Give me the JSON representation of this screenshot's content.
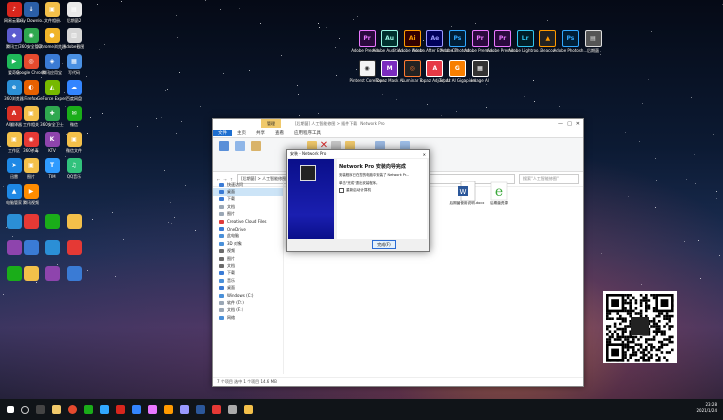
{
  "desktop_icons_left": [
    {
      "label": "网易云音乐",
      "color": "#d8261d",
      "glyph": "♪"
    },
    {
      "label": "Easy Downlo...",
      "color": "#2b5fa8",
      "glyph": "↓"
    },
    {
      "label": "文件相册",
      "color": "#f3c04a",
      "glyph": "▣"
    },
    {
      "label": "后期菌2",
      "color": "#e9e9e9",
      "glyph": "▤"
    },
    {
      "label": "腾讯工厂",
      "color": "#5c5ccf",
      "glyph": "◆"
    },
    {
      "label": "360安全管家",
      "color": "#2fa84f",
      "glyph": "◉"
    },
    {
      "label": "Chrome浏览器",
      "color": "#f0b429",
      "glyph": "●"
    },
    {
      "label": "Adobe截图",
      "color": "#d6d6d6",
      "glyph": "▥"
    },
    {
      "label": "爱奇艺",
      "color": "#1fb85a",
      "glyph": "▶"
    },
    {
      "label": "Google Chrome",
      "color": "#e64a2e",
      "glyph": "◎"
    },
    {
      "label": "腾讯应用宝",
      "color": "#3a7bd5",
      "glyph": "◈"
    },
    {
      "label": "写代码",
      "color": "#4a90e2",
      "glyph": "▦"
    },
    {
      "label": "360浏览器",
      "color": "#2b8fd6",
      "glyph": "e"
    },
    {
      "label": "Firefox",
      "color": "#e66000",
      "glyph": "◐"
    },
    {
      "label": "GeForce Experience",
      "color": "#76b900",
      "glyph": "◭"
    },
    {
      "label": "百度网盘",
      "color": "#3385ff",
      "glyph": "☁"
    },
    {
      "label": "AI翻译器",
      "color": "#d93025",
      "glyph": "A"
    },
    {
      "label": "工作相关",
      "color": "#f3c04a",
      "glyph": "▣"
    },
    {
      "label": "360安全卫士",
      "color": "#2fa84f",
      "glyph": "✚"
    },
    {
      "label": "微信",
      "color": "#1aad19",
      "glyph": "✉"
    },
    {
      "label": "工作区",
      "color": "#f3c04a",
      "glyph": "▣"
    },
    {
      "label": "360杀毒",
      "color": "#e53935",
      "glyph": "◉"
    },
    {
      "label": "KTV",
      "color": "#8e44ad",
      "glyph": "K"
    },
    {
      "label": "微信文件",
      "color": "#f3c04a",
      "glyph": "▣"
    },
    {
      "label": "迅雷",
      "color": "#1e88e5",
      "glyph": "➤"
    },
    {
      "label": "图片",
      "color": "#f3c04a",
      "glyph": "▣"
    },
    {
      "label": "TIM",
      "color": "#2f9bff",
      "glyph": "T"
    },
    {
      "label": "QQ音乐",
      "color": "#31c27c",
      "glyph": "♫"
    },
    {
      "label": "电脑管家",
      "color": "#1e88e5",
      "glyph": "▲"
    },
    {
      "label": "腾讯视频",
      "color": "#ff8c00",
      "glyph": "▶"
    }
  ],
  "desktop_apps_top": [
    {
      "label": "Adobe Premie...",
      "text": "Pr",
      "bg": "#2a0a3d",
      "fg": "#ea77ff"
    },
    {
      "label": "Adobe Audition...",
      "text": "Au",
      "bg": "#00302e",
      "fg": "#9af7e4"
    },
    {
      "label": "Adobe Illustr...",
      "text": "Ai",
      "bg": "#330000",
      "fg": "#ff9a00"
    },
    {
      "label": "Adobe After Effects CC",
      "text": "Ae",
      "bg": "#00005b",
      "fg": "#9999ff"
    },
    {
      "label": "Adobe Photosh...",
      "text": "Ps",
      "bg": "#001e36",
      "fg": "#31a8ff"
    },
    {
      "label": "Adobe Premie...",
      "text": "Pr",
      "bg": "#2a0a3d",
      "fg": "#ea77ff"
    },
    {
      "label": "Adobe Premie...",
      "text": "Pr",
      "bg": "#2a0a3d",
      "fg": "#ea77ff"
    },
    {
      "label": "Adobe Lightroo...",
      "text": "Lr",
      "bg": "#001d26",
      "fg": "#31c5f0"
    },
    {
      "label": "Beacon",
      "text": "▲",
      "bg": "#222",
      "fg": "#ff9a00"
    },
    {
      "label": "Adobe Photosh...",
      "text": "Ps",
      "bg": "#001e36",
      "fg": "#31a8ff"
    },
    {
      "label": "后期菌",
      "text": "▤",
      "bg": "#555",
      "fg": "#ddd"
    }
  ],
  "desktop_apps_row2": [
    {
      "label": "Pinterst CorelDee",
      "text": "◉",
      "bg": "#f4f4f4",
      "fg": "#333"
    },
    {
      "label": "Topaz Mask AI",
      "text": "M",
      "bg": "#7b2cbf",
      "fg": "#fff"
    },
    {
      "label": "Luminar 4",
      "text": "◎",
      "bg": "#222",
      "fg": "#ff7a30"
    },
    {
      "label": "Topaz Adjust AI",
      "text": "A",
      "bg": "#e63946",
      "fg": "#fff"
    },
    {
      "label": "Topaz AI Gigapixel",
      "text": "G",
      "bg": "#f77f00",
      "fg": "#fff"
    },
    {
      "label": "Image AI",
      "text": "▦",
      "bg": "#333",
      "fg": "#fff"
    }
  ],
  "explorer": {
    "title": "[后期菌] 人工智能修图 > 插件下载",
    "title_right": "Network Pro",
    "ribbon_tab_highlight": "管理",
    "tabs": [
      "文件",
      "主页",
      "共享",
      "查看",
      "应用程序工具"
    ],
    "address": "[后期菌] > 人工智能修图",
    "search_placeholder": "搜索\"人工智能修图\"",
    "nav_items": [
      {
        "label": "快速访问",
        "color": "#3a7bd5"
      },
      {
        "label": "桌面",
        "color": "#3a7bd5"
      },
      {
        "label": "下载",
        "color": "#3a7bd5"
      },
      {
        "label": "文档",
        "color": "#9aa7b5"
      },
      {
        "label": "图片",
        "color": "#9aa7b5"
      },
      {
        "label": "Creative Cloud Files",
        "color": "#e03a3a"
      },
      {
        "label": "OneDrive",
        "color": "#3a7bd5"
      },
      {
        "label": "此电脑",
        "color": "#4a90d9"
      },
      {
        "label": "3D 对象",
        "color": "#4a90d9"
      },
      {
        "label": "视频",
        "color": "#6b6b6b"
      },
      {
        "label": "图片",
        "color": "#6b6b6b"
      },
      {
        "label": "文档",
        "color": "#6b6b6b"
      },
      {
        "label": "下载",
        "color": "#3a7bd5"
      },
      {
        "label": "音乐",
        "color": "#4a90d9"
      },
      {
        "label": "桌面",
        "color": "#3a7bd5"
      },
      {
        "label": "Windows (C:)",
        "color": "#4a90d9"
      },
      {
        "label": "软件 (D:)",
        "color": "#9aa7b5"
      },
      {
        "label": "文档 (E:)",
        "color": "#9aa7b5"
      },
      {
        "label": "网络",
        "color": "#4a90d9"
      }
    ],
    "files": [
      {
        "label": "后期菌使用说明.docx",
        "type": "word"
      },
      {
        "label": "后期菌资源",
        "type": "ie"
      }
    ],
    "status": "7 个项目   选中 1 个项目  14.6 MB"
  },
  "dialog": {
    "title": "安装 - Network Pro",
    "heading": "Network Pro 安装向导完成",
    "para1": "安装程序已在您的电脑中安装了 Network Pr...",
    "para2": "单击\"完成\"退出安装程序。",
    "checkbox_label": "重新启动计算机",
    "finish_button": "完成(F)"
  },
  "watermark": "微信公众号：后期菌",
  "tray": {
    "time": "23:28",
    "date": "2021/1/24"
  }
}
